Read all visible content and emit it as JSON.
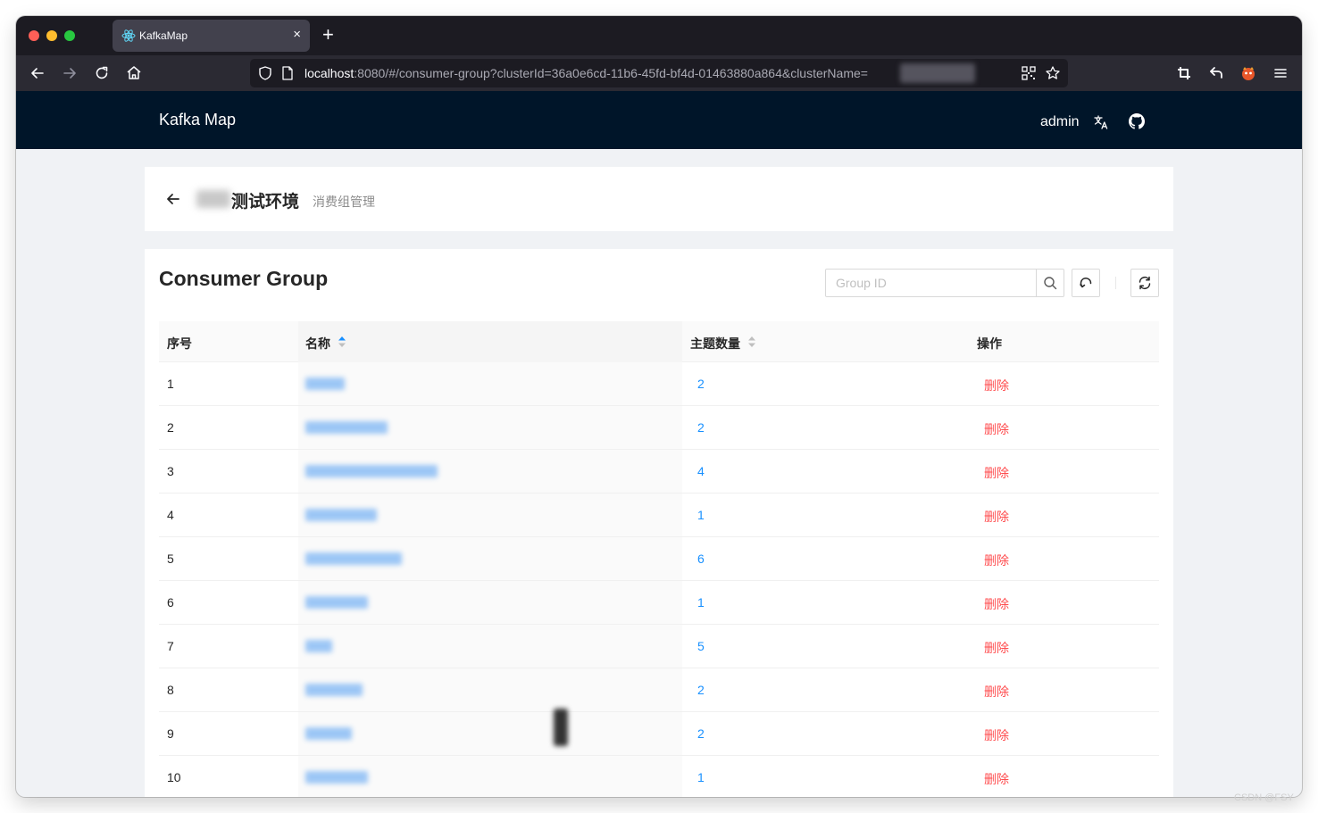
{
  "browser": {
    "tab_title": "KafkaMap",
    "new_tab_symbol": "+",
    "close_symbol": "×",
    "url_host": "localhost",
    "url_rest": ":8080/#/consumer-group?clusterId=36a0e6cd-11b6-45fd-bf4d-01463880a864&clusterName="
  },
  "app": {
    "brand": "Kafka Map",
    "user": "admin"
  },
  "breadcrumb": {
    "title": "测试环境",
    "subtitle": "消费组管理"
  },
  "main": {
    "title": "Consumer Group",
    "search_placeholder": "Group ID"
  },
  "table": {
    "columns": [
      "序号",
      "名称",
      "主题数量",
      "操作"
    ],
    "rows": [
      {
        "index": "1",
        "count": "2",
        "action": "删除"
      },
      {
        "index": "2",
        "count": "2",
        "action": "删除"
      },
      {
        "index": "3",
        "count": "4",
        "action": "删除"
      },
      {
        "index": "4",
        "count": "1",
        "action": "删除"
      },
      {
        "index": "5",
        "count": "6",
        "action": "删除"
      },
      {
        "index": "6",
        "count": "1",
        "action": "删除"
      },
      {
        "index": "7",
        "count": "5",
        "action": "删除"
      },
      {
        "index": "8",
        "count": "2",
        "action": "删除"
      },
      {
        "index": "9",
        "count": "2",
        "action": "删除"
      },
      {
        "index": "10",
        "count": "1",
        "action": "删除"
      }
    ]
  },
  "watermark": "CSDN @FSY",
  "colors": {
    "header_bg": "#001529",
    "link": "#1890ff",
    "danger": "#ff4d4f"
  }
}
